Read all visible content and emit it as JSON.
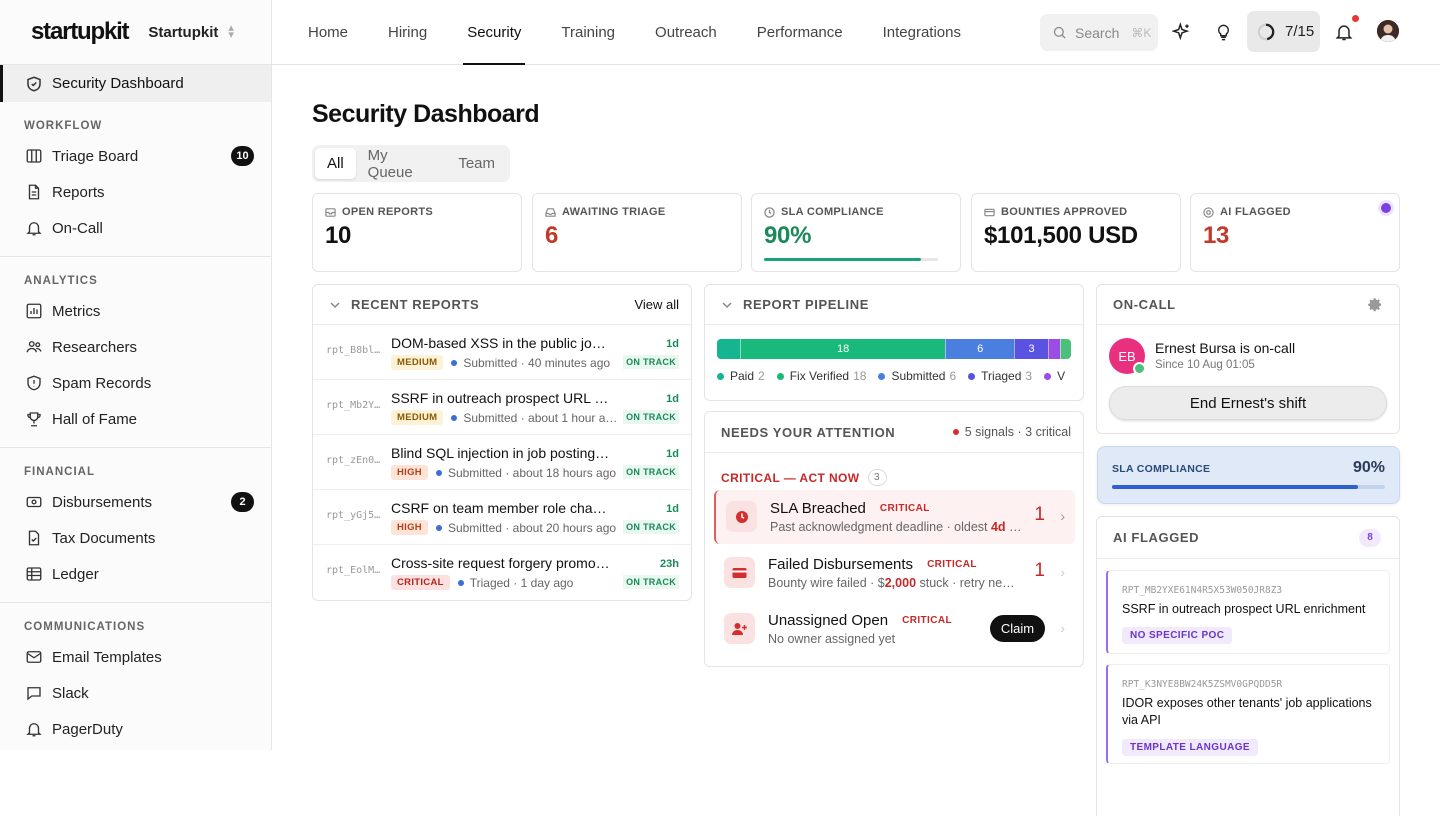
{
  "brand": {
    "logo": "startupkit",
    "workspace": "Startupkit"
  },
  "sidebar": {
    "active": "Security Dashboard",
    "sections": [
      {
        "heading": "WORKFLOW",
        "items": [
          {
            "label": "Triage Board",
            "count": "10"
          },
          {
            "label": "Reports"
          },
          {
            "label": "On-Call"
          }
        ]
      },
      {
        "heading": "ANALYTICS",
        "items": [
          {
            "label": "Metrics"
          },
          {
            "label": "Researchers"
          },
          {
            "label": "Spam Records"
          },
          {
            "label": "Hall of Fame"
          }
        ]
      },
      {
        "heading": "FINANCIAL",
        "items": [
          {
            "label": "Disbursements",
            "count": "2"
          },
          {
            "label": "Tax Documents"
          },
          {
            "label": "Ledger"
          }
        ]
      },
      {
        "heading": "COMMUNICATIONS",
        "items": [
          {
            "label": "Email Templates"
          },
          {
            "label": "Slack"
          },
          {
            "label": "PagerDuty"
          }
        ]
      }
    ]
  },
  "nav": {
    "tabs": [
      "Home",
      "Hiring",
      "Security",
      "Training",
      "Outreach",
      "Performance",
      "Integrations"
    ],
    "active": "Security"
  },
  "topbar": {
    "search_placeholder": "Search",
    "search_shortcut": "⌘K",
    "progress": "7/15",
    "progress_value": 0.47
  },
  "page": {
    "title": "Security Dashboard",
    "filters": [
      "All",
      "My Queue",
      "Team"
    ],
    "active_filter": "All"
  },
  "stats": [
    {
      "label": "OPEN REPORTS",
      "value": "10",
      "color": "#111111",
      "icon": "inbox-icon"
    },
    {
      "label": "AWAITING TRIAGE",
      "value": "6",
      "color": "#c0392b",
      "icon": "tray-icon"
    },
    {
      "label": "SLA COMPLIANCE",
      "value": "90%",
      "color": "#1a8a5a",
      "icon": "clock-icon",
      "bar": 0.9
    },
    {
      "label": "BOUNTIES APPROVED",
      "value": "$101,500 USD",
      "color": "#111111",
      "icon": "wallet-icon"
    },
    {
      "label": "AI FLAGGED",
      "value": "13",
      "color": "#c0392b",
      "icon": "target-icon"
    }
  ],
  "recent": {
    "title": "RECENT REPORTS",
    "view_all": "View all",
    "rows": [
      {
        "id": "rpt_B8bl…",
        "title": "DOM-based XSS in the public job…",
        "severity": "MEDIUM",
        "meta": "Submitted · 40 minutes ago",
        "age": "1d",
        "status": "ON TRACK"
      },
      {
        "id": "rpt_Mb2Y…",
        "title": "SSRF in outreach prospect URL e…",
        "severity": "MEDIUM",
        "meta": "Submitted · about 1 hour a…",
        "age": "1d",
        "status": "ON TRACK"
      },
      {
        "id": "rpt_zEn0…",
        "title": "Blind SQL injection in job posting …",
        "severity": "HIGH",
        "meta": "Submitted · about 18 hours ago",
        "age": "1d",
        "status": "ON TRACK"
      },
      {
        "id": "rpt_yGj5…",
        "title": "CSRF on team member role chan…",
        "severity": "HIGH",
        "meta": "Submitted · about 20 hours ago",
        "age": "1d",
        "status": "ON TRACK"
      },
      {
        "id": "rpt_EolM…",
        "title": "Cross-site request forgery promo…",
        "severity": "CRITICAL",
        "meta": "Triaged · 1 day ago",
        "age": "23h",
        "status": "ON TRACK"
      }
    ]
  },
  "pipeline": {
    "title": "REPORT PIPELINE",
    "segments": [
      {
        "name": "Paid",
        "value": 2,
        "color": "#14b58f",
        "show": ""
      },
      {
        "name": "Fix Verified",
        "value": 18,
        "color": "#18b97a",
        "show": "18"
      },
      {
        "name": "Submitted",
        "value": 6,
        "color": "#4a7fe0",
        "show": "6"
      },
      {
        "name": "Triaged",
        "value": 3,
        "color": "#5a52e0",
        "show": "3"
      },
      {
        "name": "V",
        "value": 1,
        "color": "#9b4de6",
        "show": ""
      },
      {
        "name": "",
        "value": 1,
        "color": "#4cc07a",
        "show": ""
      }
    ],
    "legend": [
      {
        "name": "Paid",
        "n": "2",
        "color": "#14b58f"
      },
      {
        "name": "Fix Verified",
        "n": "18",
        "color": "#18b97a"
      },
      {
        "name": "Submitted",
        "n": "6",
        "color": "#4a7fe0"
      },
      {
        "name": "Triaged",
        "n": "3",
        "color": "#5a52e0"
      },
      {
        "name": "V",
        "n": "",
        "color": "#9b4de6"
      }
    ]
  },
  "attention": {
    "title": "NEEDS YOUR ATTENTION",
    "summary": "5 signals · 3 critical",
    "sub": "CRITICAL — ACT NOW",
    "sub_count": "3",
    "items": [
      {
        "title": "SLA Breached",
        "tag": "CRITICAL",
        "pre": "Past acknowledgment deadline · oldest ",
        "strong": "4d",
        "post": " …",
        "count": "1"
      },
      {
        "title": "Failed Disbursements",
        "tag": "CRITICAL",
        "pre": "Bounty wire failed · $",
        "strong": "2,000",
        "post": " stuck · retry ne…",
        "count": "1"
      },
      {
        "title": "Unassigned Open",
        "tag": "CRITICAL",
        "pre": "No owner assigned yet",
        "strong": "",
        "post": "",
        "action": "Claim"
      }
    ]
  },
  "oncall": {
    "title": "ON-CALL",
    "initials": "EB",
    "name": "Ernest Bursa is on-call",
    "since": "Since 10 Aug 01:05",
    "button": "End Ernest's shift"
  },
  "sla_card": {
    "label": "SLA COMPLIANCE",
    "value": "90%",
    "fraction": 0.9
  },
  "ai_flagged": {
    "title": "AI FLAGGED",
    "count": "8",
    "cards": [
      {
        "id": "RPT_MB2YXE61N4R5X53W050JR8Z3",
        "title": "SSRF in outreach prospect URL enrichment",
        "tag": "NO SPECIFIC POC"
      },
      {
        "id": "RPT_K3NYE8BW24K5ZSMV0GPQDD5R",
        "title": "IDOR exposes other tenants' job applications via API",
        "tag": "TEMPLATE LANGUAGE"
      }
    ]
  }
}
